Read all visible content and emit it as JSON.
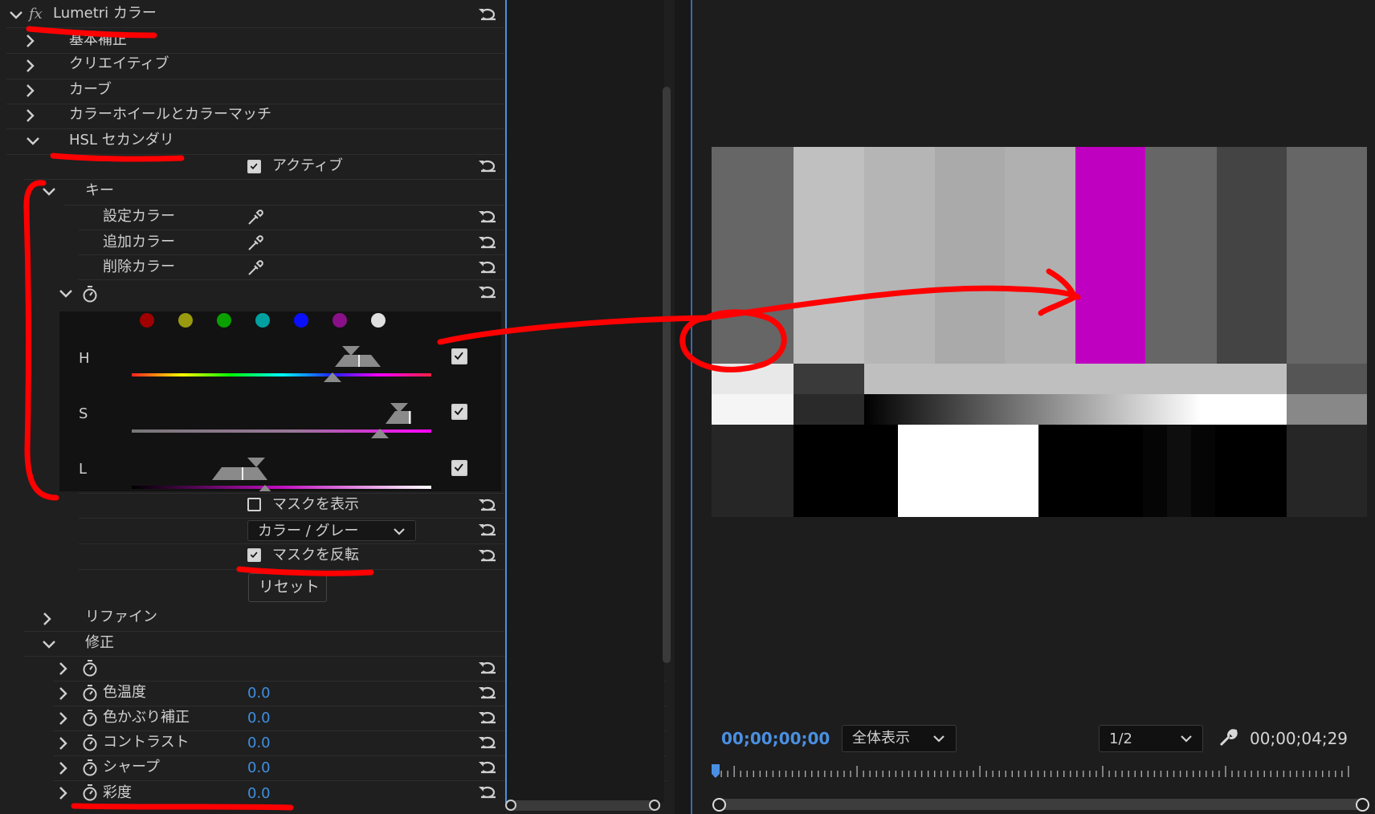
{
  "panel": {
    "fx_symbol": "fx",
    "effect_title": "Lumetri カラー",
    "sections": {
      "basic": "基本補正",
      "creative": "クリエイティブ",
      "curves": "カーブ",
      "wheels": "カラーホイールとカラーマッチ",
      "hsl": "HSL セカンダリ"
    },
    "active_label": "アクティブ",
    "key": {
      "title": "キー",
      "set_color": "設定カラー",
      "add_color": "追加カラー",
      "remove_color": "削除カラー"
    },
    "swatches": [
      "#a00000",
      "#9a9a10",
      "#0aa000",
      "#00a0a0",
      "#0a10ff",
      "#8a108a",
      "#e0e0e0"
    ],
    "channels": {
      "h": "H",
      "s": "S",
      "l": "L"
    },
    "show_mask": "マスクを表示",
    "mask_mode": "カラー / グレー",
    "invert_mask": "マスクを反転",
    "reset_button": "リセット",
    "refine": "リファイン",
    "correction": "修正",
    "params": [
      {
        "label": "色温度",
        "value": "0.0"
      },
      {
        "label": "色かぶり補正",
        "value": "0.0"
      },
      {
        "label": "コントラスト",
        "value": "0.0"
      },
      {
        "label": "シャープ",
        "value": "0.0"
      },
      {
        "label": "彩度",
        "value": "0.0"
      }
    ]
  },
  "viewer": {
    "timecode_current": "00;00;00;00",
    "zoom": "全体表示",
    "resolution": "1/2",
    "timecode_duration": "00;00;04;29",
    "accent_color": "#4a90e2"
  }
}
